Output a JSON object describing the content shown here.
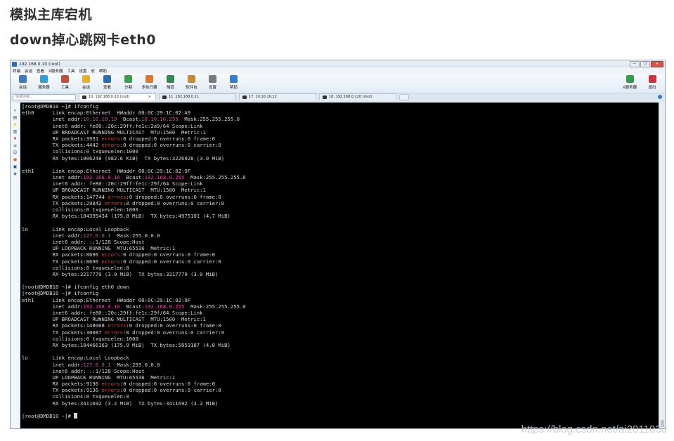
{
  "article": {
    "title1": "模拟主库宕机",
    "title2": "down掉心跳网卡eth0"
  },
  "window": {
    "title": "192.168.0.10 (root)",
    "buttons": [
      "—",
      "□",
      "✕"
    ]
  },
  "menu": [
    "终端",
    "会话",
    "查看",
    "X服务器",
    "工具",
    "设置",
    "宏",
    "帮助"
  ],
  "toolbar": [
    {
      "label": "会话",
      "icon": "session-icon",
      "color": "#3a78c9"
    },
    {
      "label": "服务器",
      "icon": "servers-icon",
      "color": "#2f9de0"
    },
    {
      "label": "工具",
      "icon": "tools-icon",
      "color": "#c94b3a"
    },
    {
      "label": "会话",
      "icon": "star-session-icon",
      "color": "#e8b21f"
    },
    {
      "label": "查看",
      "icon": "view-icon",
      "color": "#2b6fb3"
    },
    {
      "label": "分割",
      "icon": "split-icon",
      "color": "#3aa04b"
    },
    {
      "label": "多执行器",
      "icon": "multiexec-icon",
      "color": "#e0762a"
    },
    {
      "label": "隧道",
      "icon": "tunnel-icon",
      "color": "#2f8a4e"
    },
    {
      "label": "软件包",
      "icon": "packages-icon",
      "color": "#c98a2f"
    },
    {
      "label": "设置",
      "icon": "settings-icon",
      "color": "#7a7a7a"
    },
    {
      "label": "帮助",
      "icon": "help-icon",
      "color": "#2f7fd0"
    }
  ],
  "toolbar_right": [
    {
      "label": "X服务器",
      "icon": "x-server-icon",
      "color": "#2fa04a"
    },
    {
      "label": "退出",
      "icon": "exit-icon",
      "color": "#d2313a"
    }
  ],
  "quick_connect": {
    "placeholder": "快速连接..."
  },
  "tabs": [
    {
      "label": "10. 192.168.0.10 (root)",
      "active": true
    },
    {
      "label": "11. 192.168.0.11",
      "active": false
    },
    {
      "label": "17. 10.10.10.12",
      "active": false
    },
    {
      "label": "18. 192.168.0.120 (root)",
      "active": false
    }
  ],
  "terminal_lines": [
    [
      {
        "t": "[root@DMDB10 ~]# ifconfig"
      }
    ],
    [
      {
        "t": "eth0      Link encap:Ethernet  HWaddr 00:0C:29:1C:02:A9"
      }
    ],
    [
      {
        "t": "          inet addr:"
      },
      {
        "t": "10.10.10.10",
        "c": "hl"
      },
      {
        "t": "  Bcast:"
      },
      {
        "t": "10.10.10.255",
        "c": "hl"
      },
      {
        "t": "  Mask:255.255.255.0"
      }
    ],
    [
      {
        "t": "          inet6 addr: fe80::20c:29ff:fe1c:2a9/64 Scope:Link"
      }
    ],
    [
      {
        "t": "          UP BROADCAST RUNNING MULTICAST  MTU:1500  Metric:1"
      }
    ],
    [
      {
        "t": "          RX packets:3931 "
      },
      {
        "t": "errors",
        "c": "err"
      },
      {
        "t": ":0 dropped:0 overruns:0 frame:0"
      }
    ],
    [
      {
        "t": "          TX packets:4442 "
      },
      {
        "t": "errors",
        "c": "err"
      },
      {
        "t": ":0 dropped:0 overruns:0 carrier:0"
      }
    ],
    [
      {
        "t": "          collisions:0 txqueuelen:1000"
      }
    ],
    [
      {
        "t": "          RX bytes:1006248 (982.6 KiB)  TX bytes:3226928 (3.0 MiB)"
      }
    ],
    [
      {
        "t": ""
      }
    ],
    [
      {
        "t": "eth1      Link encap:Ethernet  HWaddr 00:0C:29:1C:02:9F"
      }
    ],
    [
      {
        "t": "          inet addr:"
      },
      {
        "t": "192.168.0.10",
        "c": "hl"
      },
      {
        "t": "  Bcast:"
      },
      {
        "t": "192.168.0.255",
        "c": "hl"
      },
      {
        "t": "  Mask:255.255.255.0"
      }
    ],
    [
      {
        "t": "          inet6 addr: fe80::20c:29ff:fe1c:29f/64 Scope:Link"
      }
    ],
    [
      {
        "t": "          UP BROADCAST RUNNING MULTICAST  MTU:1500  Metric:1"
      }
    ],
    [
      {
        "t": "          RX packets:147744 "
      },
      {
        "t": "errors",
        "c": "err"
      },
      {
        "t": ":0 dropped:0 overruns:0 frame:0"
      }
    ],
    [
      {
        "t": "          TX packets:29842 "
      },
      {
        "t": "errors",
        "c": "err"
      },
      {
        "t": ":0 dropped:0 overruns:0 carrier:0"
      }
    ],
    [
      {
        "t": "          collisions:0 txqueuelen:1000"
      }
    ],
    [
      {
        "t": "          RX bytes:184395434 (175.8 MiB)  TX bytes:4975101 (4.7 MiB)"
      }
    ],
    [
      {
        "t": ""
      }
    ],
    [
      {
        "t": "lo        Link encap:Local Loopback"
      }
    ],
    [
      {
        "t": "          inet addr:"
      },
      {
        "t": "127.0.0.1",
        "c": "hl"
      },
      {
        "t": "  Mask:255.0.0.0"
      }
    ],
    [
      {
        "t": "          inet6 addr: ::1/128 Scope:Host"
      }
    ],
    [
      {
        "t": "          UP LOOPBACK RUNNING  MTU:65536  Metric:1"
      }
    ],
    [
      {
        "t": "          RX packets:8696 "
      },
      {
        "t": "errors",
        "c": "err"
      },
      {
        "t": ":0 dropped:0 overruns:0 frame:0"
      }
    ],
    [
      {
        "t": "          TX packets:8696 "
      },
      {
        "t": "errors",
        "c": "err"
      },
      {
        "t": ":0 dropped:0 overruns:0 carrier:0"
      }
    ],
    [
      {
        "t": "          collisions:0 txqueuelen:0"
      }
    ],
    [
      {
        "t": "          RX bytes:3217779 (3.0 MiB)  TX bytes:3217779 (3.0 MiB)"
      }
    ],
    [
      {
        "t": ""
      }
    ],
    [
      {
        "t": "[root@DMDB10 ~]# ifconfig eth0 down"
      }
    ],
    [
      {
        "t": "[root@DMDB10 ~]# ifconfig"
      }
    ],
    [
      {
        "t": "eth1      Link encap:Ethernet  HWaddr 00:0C:29:1C:02:9F"
      }
    ],
    [
      {
        "t": "          inet addr:"
      },
      {
        "t": "192.168.0.10",
        "c": "hl"
      },
      {
        "t": "  Bcast:"
      },
      {
        "t": "192.168.0.255",
        "c": "hl"
      },
      {
        "t": "  Mask:255.255.255.0"
      }
    ],
    [
      {
        "t": "          inet6 addr: fe80::20c:29ff:fe1c:29f/64 Scope:Link"
      }
    ],
    [
      {
        "t": "          UP BROADCAST RUNNING MULTICAST  MTU:1500  Metric:1"
      }
    ],
    [
      {
        "t": "          RX packets:148008 "
      },
      {
        "t": "errors",
        "c": "err"
      },
      {
        "t": ":0 dropped:0 overruns:0 frame:0"
      }
    ],
    [
      {
        "t": "          TX packets:30087 "
      },
      {
        "t": "errors",
        "c": "err"
      },
      {
        "t": ":0 dropped:0 overruns:0 carrier:0"
      }
    ],
    [
      {
        "t": "          collisions:0 txqueuelen:1000"
      }
    ],
    [
      {
        "t": "          RX bytes:184466163 (175.9 MiB)  TX bytes:5059187 (4.8 MiB)"
      }
    ],
    [
      {
        "t": ""
      }
    ],
    [
      {
        "t": "lo        Link encap:Local Loopback"
      }
    ],
    [
      {
        "t": "          inet addr:"
      },
      {
        "t": "127.0.0.1",
        "c": "hl"
      },
      {
        "t": "  Mask:255.0.0.0"
      }
    ],
    [
      {
        "t": "          inet6 addr: ::1/128 Scope:Host"
      }
    ],
    [
      {
        "t": "          UP LOOPBACK RUNNING  MTU:65536  Metric:1"
      }
    ],
    [
      {
        "t": "          RX packets:9136 "
      },
      {
        "t": "errors",
        "c": "err"
      },
      {
        "t": ":0 dropped:0 overruns:0 frame:0"
      }
    ],
    [
      {
        "t": "          TX packets:9136 "
      },
      {
        "t": "errors",
        "c": "err"
      },
      {
        "t": ":0 dropped:0 overruns:0 carrier:0"
      }
    ],
    [
      {
        "t": "          collisions:0 txqueuelen:0"
      }
    ],
    [
      {
        "t": "          RX bytes:3411692 (3.2 MiB)  TX bytes:3411692 (3.2 MiB)"
      }
    ],
    [
      {
        "t": ""
      }
    ],
    [
      {
        "t": "[root@DMDB10 ~]# "
      },
      {
        "cursor": true
      }
    ]
  ],
  "watermark": "https://blog.csdn.net/ai2011030"
}
